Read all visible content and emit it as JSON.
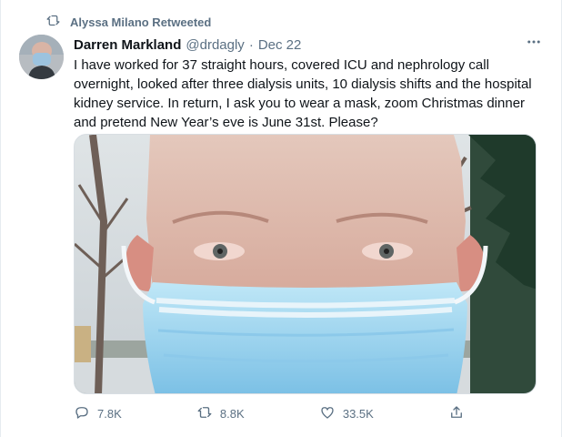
{
  "tweet": {
    "retweet_context": "Alyssa Milano Retweeted",
    "author_name": "Darren Markland",
    "author_handle": "@drdagly",
    "separator": "·",
    "date": "Dec 22",
    "text": "I have worked for 37 straight hours, covered ICU and nephrology call overnight, looked after three dialysis units, 10 dialysis shifts and the hospital kidney service. In return, I ask you to wear a mask, zoom Christmas dinner and pretend New Year’s eve is June 31st. Please?",
    "actions": {
      "reply_count": "7.8K",
      "retweet_count": "8.8K",
      "like_count": "33.5K"
    },
    "icons": {
      "retweet_context": "retweet-icon",
      "more": "more-options-icon",
      "reply": "reply-icon",
      "retweet": "retweet-icon",
      "like": "like-icon",
      "share": "share-icon"
    },
    "colors": {
      "text": "#0f1419",
      "secondary": "#5b7083",
      "border": "#e6ecf0"
    }
  }
}
